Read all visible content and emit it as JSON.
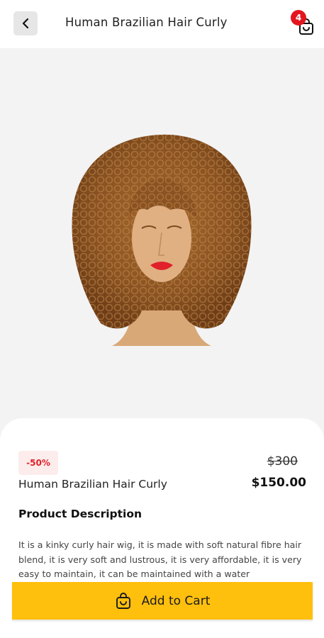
{
  "header": {
    "title": "Human Brazilian Hair Curly",
    "cart_count": "4",
    "back_icon": "chevron-left-icon",
    "cart_icon": "shopping-bag-icon"
  },
  "product": {
    "image": "curly-wig-mannequin",
    "discount": "-50%",
    "old_price": "$300",
    "price": "$150.00",
    "name": "Human Brazilian Hair Curly",
    "description_heading": "Product Description",
    "description": "It is a kinky curly hair wig, it is made with soft natural fibre hair blend, it is very soft and lustrous, it is very affordable, it is very easy to maintain, it can be maintained with a water"
  },
  "actions": {
    "add_to_cart_label": "Add to Cart",
    "add_to_cart_icon": "shopping-bag-icon"
  },
  "colors": {
    "accent": "#ffbf0d",
    "badge": "#e3161f",
    "discount_text": "#e0202a",
    "discount_bg": "#fdecec"
  }
}
